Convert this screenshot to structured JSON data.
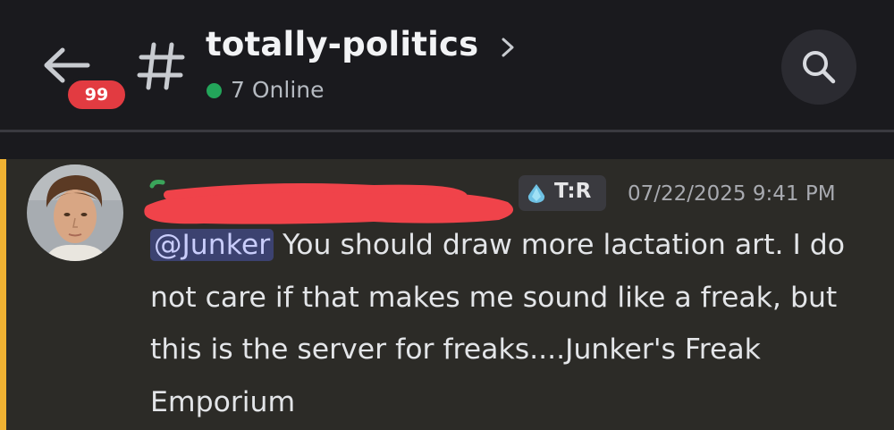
{
  "header": {
    "back_icon": "arrow-left-icon",
    "unread_badge": "99",
    "channel_icon": "hash-icon",
    "channel_name": "totally-politics",
    "chevron_icon": "chevron-right-icon",
    "online_status": "7 Online",
    "online_color": "#23a55a",
    "search_icon": "search-icon"
  },
  "message": {
    "highlight_color": "#f0b232",
    "avatar": "avatar",
    "author_redacted": true,
    "role_icon": "droplet-icon",
    "role_tag": "T:R",
    "timestamp": "07/22/2025 9:41 PM",
    "mention": "@Junker",
    "text": " You should draw more lactation art. I do not care if that makes me sound like a freak, but this is the server for freaks....Junker's Freak Emporium"
  }
}
